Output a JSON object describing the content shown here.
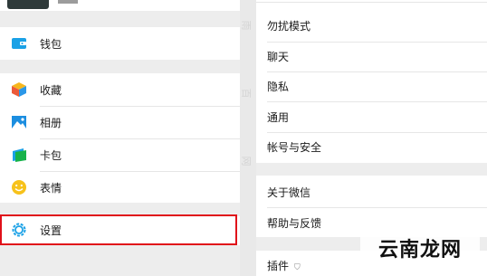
{
  "left_menu": {
    "wallet": "钱包",
    "favorites": "收藏",
    "album": "相册",
    "cards": "卡包",
    "stickers": "表情",
    "settings": "设置"
  },
  "right_menu": {
    "dnd": "勿扰模式",
    "chat": "聊天",
    "privacy": "隐私",
    "general": "通用",
    "account_security": "帐号与安全",
    "about": "关于微信",
    "help_feedback": "帮助与反馈",
    "plugins": "插件"
  },
  "watermark": "云南龙网",
  "colors": {
    "highlight": "#e0101a",
    "wallet_icon": "#1aa1e6",
    "settings_icon": "#1aa1e6",
    "sticker_icon": "#f7c21b"
  },
  "icons": {
    "wallet": "wallet-icon",
    "favorites": "cube-icon",
    "album": "picture-icon",
    "cards": "card-icon",
    "stickers": "smiley-icon",
    "settings": "gear-icon",
    "plugins": "shield-icon"
  }
}
